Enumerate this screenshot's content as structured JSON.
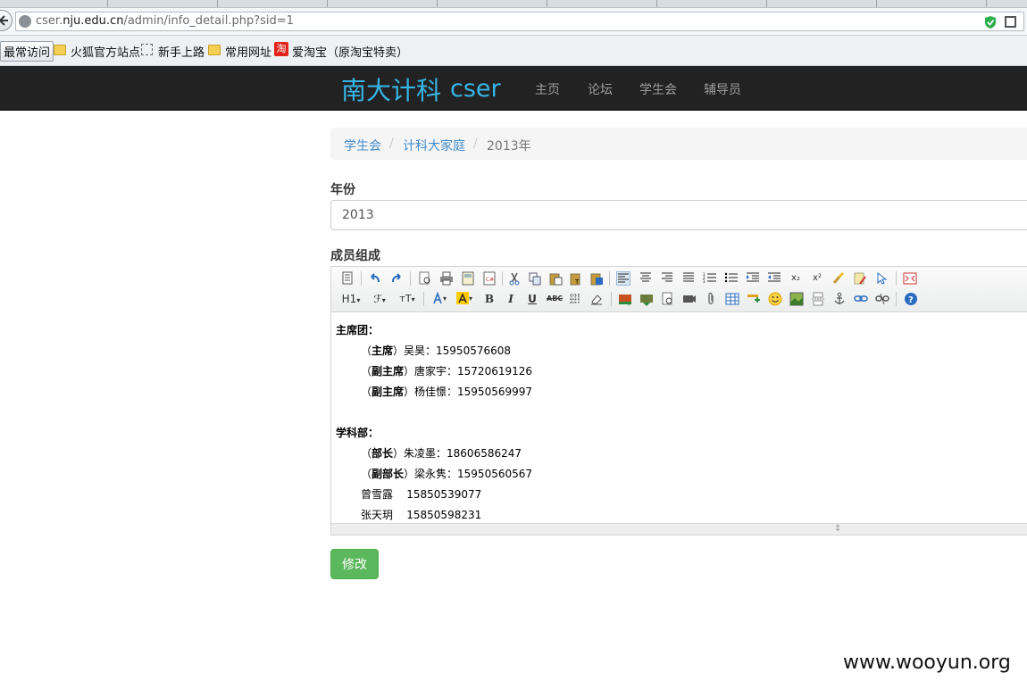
{
  "browser": {
    "url_prefix": "cser.",
    "url_domain": "nju.edu.cn",
    "url_path": "/admin/info_detail.php?sid=1",
    "bookmarks": [
      "最常访问",
      "火狐官方站点",
      "新手上路",
      "常用网址",
      "爱淘宝（原淘宝特卖）"
    ],
    "taobao_glyph": "淘"
  },
  "navbar": {
    "brand_cn": "南大计科",
    "brand_en": "cser",
    "links": [
      "主页",
      "论坛",
      "学生会",
      "辅导员"
    ]
  },
  "breadcrumb": {
    "items": [
      "学生会",
      "计科大家庭"
    ],
    "active": "2013年",
    "separator": "/"
  },
  "form": {
    "year_label": "年份",
    "year_value": "2013",
    "members_label": "成员组成",
    "submit_label": "修改"
  },
  "editor": {
    "toolbar_row2_text": {
      "h1": "H1",
      "font": "ℱ",
      "size": "тT",
      "bold": "B",
      "italic": "I",
      "underline": "U",
      "strike": "ABC",
      "sub": "x₂",
      "sup": "x²"
    },
    "content": {
      "s1_title": "主席团：",
      "s1_l1_prefix": "（",
      "s1_l1_role": "主席",
      "s1_l1_rest": "）吴昊：15950576608",
      "s1_l2_prefix": "（",
      "s1_l2_role": "副主席",
      "s1_l2_rest": "）唐家宇：15720619126",
      "s1_l3_prefix": "（",
      "s1_l3_role": "副主席",
      "s1_l3_rest": "）杨佳憬：15950569997",
      "s2_title": "学科部：",
      "s2_l1_prefix": "（",
      "s2_l1_role": "部长",
      "s2_l1_rest": "）朱凌墨：18606586247",
      "s2_l2_prefix": "（",
      "s2_l2_role": "副部长",
      "s2_l2_rest": "）梁永隽：15950560567",
      "s2_l3": "曾雪露    15850539077",
      "s2_l4": "张天玥    15850598231"
    }
  },
  "watermark": "www.wooyun.org",
  "colors": {
    "navbar_bg": "#222222",
    "brand": "#36b6e6",
    "link": "#428bca",
    "success": "#5cb85c"
  }
}
